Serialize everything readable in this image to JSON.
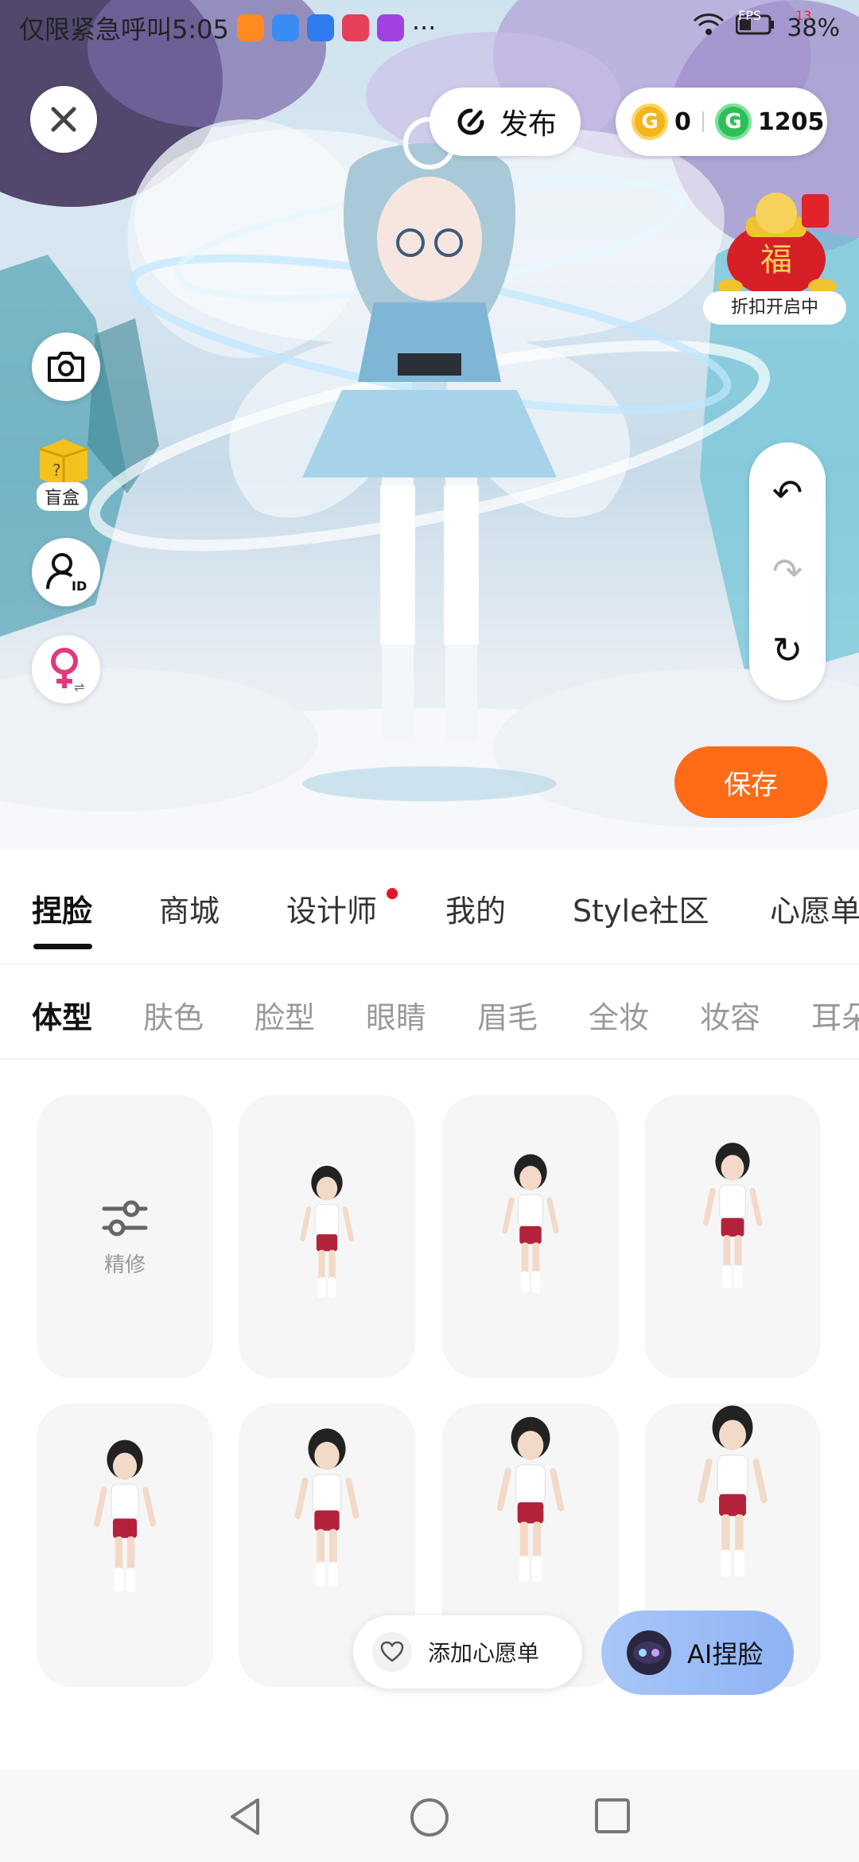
{
  "status_bar": {
    "text": "仅限紧急呼叫5:05",
    "battery": "38%",
    "fps_label": "FPS",
    "fps_value": "13",
    "more": "···"
  },
  "top_bar": {
    "publish_label": "发布",
    "coin_gold_value": "0",
    "coin_green_value": "1205",
    "promo_label": "折扣开启中"
  },
  "side_tools": {
    "blind_box_label": "盲盒"
  },
  "save_label": "保存",
  "main_tabs": [
    "捏脸",
    "商城",
    "设计师",
    "我的",
    "Style社区",
    "心愿单"
  ],
  "sub_tabs": [
    "体型",
    "肤色",
    "脸型",
    "眼睛",
    "眉毛",
    "全妆",
    "妆容",
    "耳朵"
  ],
  "grid": {
    "refine_label": "精修"
  },
  "floating": {
    "wishlist_label": "添加心愿单",
    "ai_label": "AI捏脸"
  },
  "colors": {
    "accent_orange": "#ff6b16",
    "badge_red": "#e8152a",
    "coin_gold": "#f3b51c",
    "coin_green": "#2fbf5a",
    "ai_button": "#8eb3f5"
  }
}
